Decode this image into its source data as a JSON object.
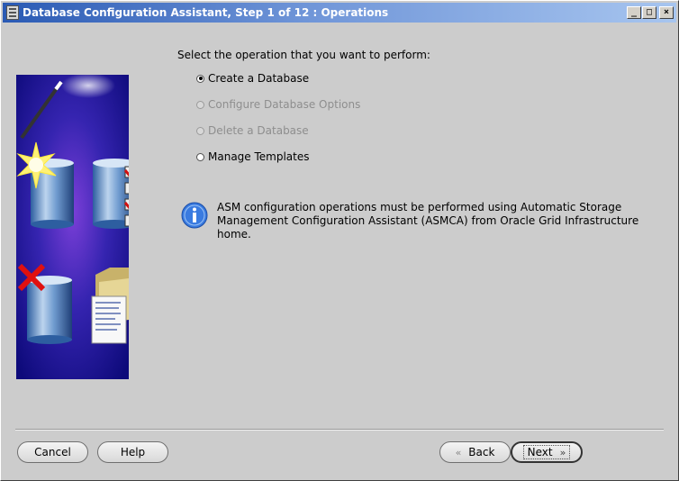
{
  "window": {
    "title": "Database Configuration Assistant, Step 1 of 12 : Operations",
    "min_glyph": "_",
    "max_glyph": "□",
    "close_glyph": "×"
  },
  "main": {
    "prompt": "Select the operation that you want to perform:",
    "options": [
      {
        "label": "Create a Database",
        "selected": true,
        "enabled": true
      },
      {
        "label": "Configure Database Options",
        "selected": false,
        "enabled": false
      },
      {
        "label": "Delete a Database",
        "selected": false,
        "enabled": false
      },
      {
        "label": "Manage Templates",
        "selected": false,
        "enabled": true
      }
    ],
    "info_line1": "ASM configuration operations must be performed using Automatic Storage",
    "info_line2": "Management Configuration Assistant (ASMCA) from Oracle Grid Infrastructure home."
  },
  "buttons": {
    "cancel": "Cancel",
    "help": "Help",
    "back": "Back",
    "next": "Next",
    "back_chevron": "«",
    "next_chevron": "»"
  },
  "colors": {
    "titlebar_start": "#2a5ab4",
    "art_background": "#2b1f9e",
    "info_blue": "#3a7be0",
    "check_red": "#d41010"
  }
}
